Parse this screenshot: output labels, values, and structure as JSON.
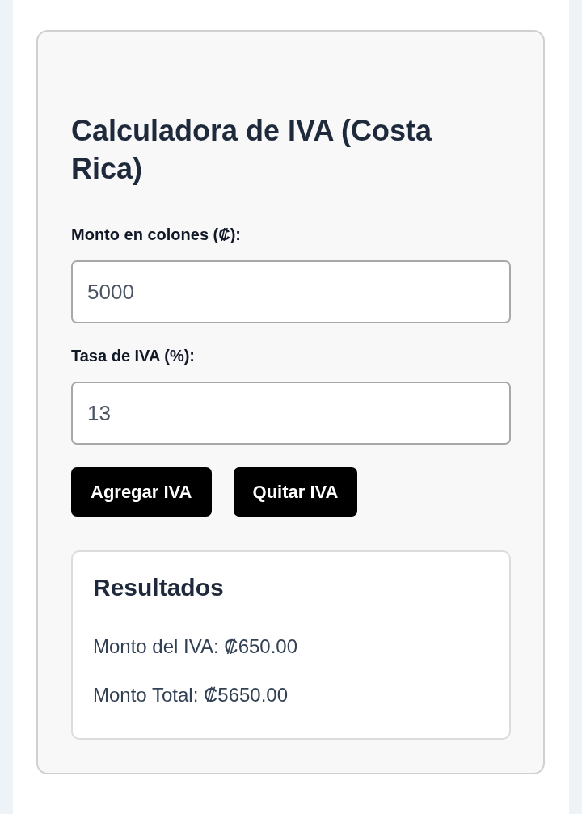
{
  "title": "Calculadora de IVA (Costa Rica)",
  "fields": [
    {
      "label": "Monto en colones (₡):",
      "value": "5000"
    },
    {
      "label": "Tasa de IVA (%):",
      "value": "13"
    }
  ],
  "buttons": [
    "Agregar IVA",
    "Quitar IVA"
  ],
  "results": {
    "title": "Resultados",
    "lines": [
      "Monto del IVA: ₡650.00",
      "Monto Total: ₡5650.00"
    ]
  }
}
